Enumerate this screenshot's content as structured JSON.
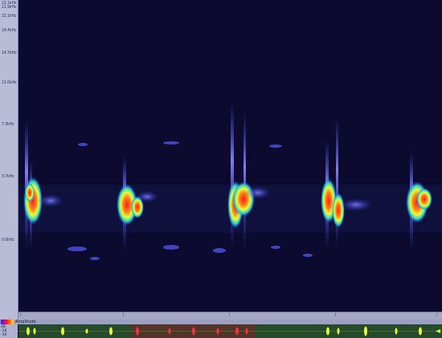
{
  "y_axis": {
    "ticks": [
      "22.1kHz",
      "18.4kHz",
      "14.7kHz",
      "11.0kHz",
      "7.3kHz",
      "3.7kHz",
      "0.0kHz"
    ],
    "top_lines": [
      "22.1kHz",
      "21.9kHz"
    ]
  },
  "spectrogram": {
    "colors": {
      "background": "#0c0b2f",
      "low": "#3a3cff",
      "mid": "#2bd4c0",
      "high": "#e8ff3a",
      "peak": "#ff2020"
    }
  },
  "amplitude_panel": {
    "label": "Amplitude",
    "side_labels": [
      "dB",
      "-18",
      "-36"
    ],
    "colors": {
      "track": "#274a2a",
      "normal": "#e6ff3a",
      "selected": "#ff3030",
      "selection_band": "#6a2a2a"
    }
  }
}
